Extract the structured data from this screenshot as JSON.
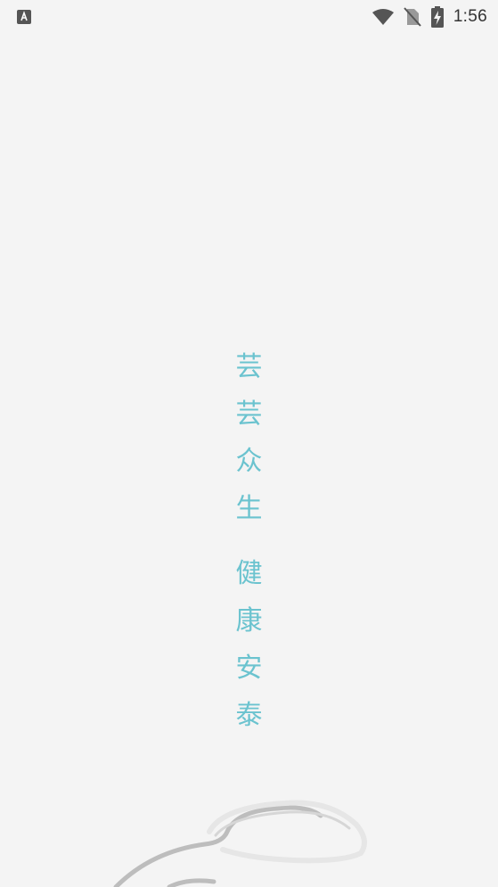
{
  "status_bar": {
    "time": "1:56",
    "icons": [
      "notification-a-icon",
      "wifi-icon",
      "no-sim-icon",
      "battery-charging-icon"
    ]
  },
  "slogan": {
    "line1": [
      "芸",
      "芸",
      "众",
      "生"
    ],
    "line2": [
      "健",
      "康",
      "安",
      "泰"
    ]
  },
  "colors": {
    "background": "#f4f4f4",
    "accent": "#6bc3cf"
  },
  "decoration": {
    "image": "stethoscope-illustration"
  }
}
